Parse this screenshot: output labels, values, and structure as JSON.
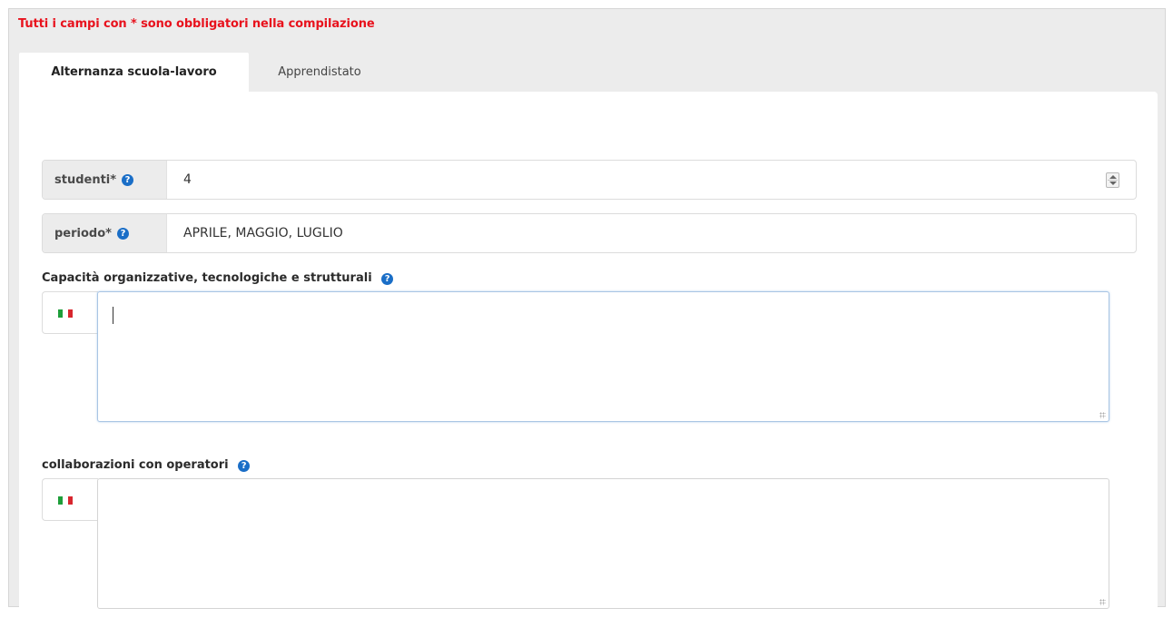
{
  "notice": "Tutti i campi con * sono obbligatori nella compilazione",
  "tabs": [
    {
      "label": "Alternanza scuola-lavoro",
      "active": true
    },
    {
      "label": "Apprendistato",
      "active": false
    }
  ],
  "fields": {
    "studenti": {
      "label": "studenti*",
      "value": "4",
      "help_icon": "question-circle-icon"
    },
    "periodo": {
      "label": "periodo*",
      "value": "APRILE, MAGGIO, LUGLIO",
      "help_icon": "question-circle-icon"
    }
  },
  "textareas": {
    "capacita": {
      "label": "Capacità organizzative, tecnologiche e strutturali",
      "value": "",
      "flag": "italian-flag-icon"
    },
    "collaborazioni": {
      "label": "collaborazioni con operatori",
      "value": "",
      "flag": "italian-flag-icon"
    }
  },
  "help_glyph": "?",
  "colors": {
    "required": "#e8121d",
    "help": "#1a6ec7",
    "flag": [
      "#1e9e3a",
      "#ffffff",
      "#d8262e"
    ]
  }
}
